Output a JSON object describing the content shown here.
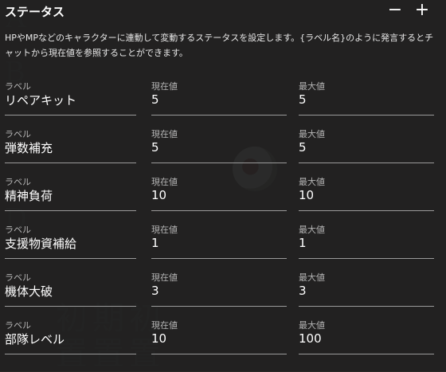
{
  "header": {
    "title": "ステータス",
    "minus_label": "−",
    "plus_label": "+"
  },
  "description": "HPやMPなどのキャラクターに連動して変動するステータスを設定します。{ラベル名}のように発言するとチャットから現在値を参照することができます。",
  "column_labels": {
    "label": "ラベル",
    "current": "現在値",
    "max": "最大値"
  },
  "rows": [
    {
      "label": "リペアキット",
      "current": "5",
      "max": "5"
    },
    {
      "label": "弾数補充",
      "current": "5",
      "max": "5"
    },
    {
      "label": "精神負荷",
      "current": "10",
      "max": "10"
    },
    {
      "label": "支援物資補給",
      "current": "1",
      "max": "1"
    },
    {
      "label": "機体大破",
      "current": "3",
      "max": "3"
    },
    {
      "label": "部隊レベル",
      "current": "10",
      "max": "100"
    }
  ],
  "colors": {
    "panel_bg": "#212121",
    "text": "#ffffff",
    "muted_text": "#b5b5b5",
    "underline": "#9a9a9a"
  }
}
